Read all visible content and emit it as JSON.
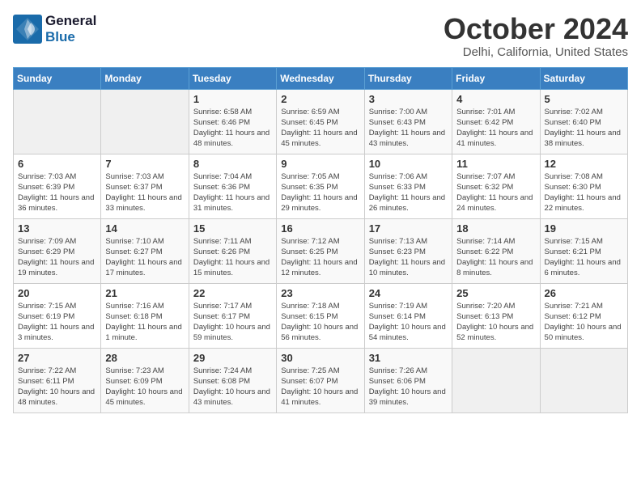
{
  "header": {
    "logo": {
      "line1": "General",
      "line2": "Blue"
    },
    "month": "October 2024",
    "location": "Delhi, California, United States"
  },
  "columns": [
    "Sunday",
    "Monday",
    "Tuesday",
    "Wednesday",
    "Thursday",
    "Friday",
    "Saturday"
  ],
  "weeks": [
    [
      {
        "day": "",
        "sunrise": "",
        "sunset": "",
        "daylight": ""
      },
      {
        "day": "",
        "sunrise": "",
        "sunset": "",
        "daylight": ""
      },
      {
        "day": "1",
        "sunrise": "Sunrise: 6:58 AM",
        "sunset": "Sunset: 6:46 PM",
        "daylight": "Daylight: 11 hours and 48 minutes."
      },
      {
        "day": "2",
        "sunrise": "Sunrise: 6:59 AM",
        "sunset": "Sunset: 6:45 PM",
        "daylight": "Daylight: 11 hours and 45 minutes."
      },
      {
        "day": "3",
        "sunrise": "Sunrise: 7:00 AM",
        "sunset": "Sunset: 6:43 PM",
        "daylight": "Daylight: 11 hours and 43 minutes."
      },
      {
        "day": "4",
        "sunrise": "Sunrise: 7:01 AM",
        "sunset": "Sunset: 6:42 PM",
        "daylight": "Daylight: 11 hours and 41 minutes."
      },
      {
        "day": "5",
        "sunrise": "Sunrise: 7:02 AM",
        "sunset": "Sunset: 6:40 PM",
        "daylight": "Daylight: 11 hours and 38 minutes."
      }
    ],
    [
      {
        "day": "6",
        "sunrise": "Sunrise: 7:03 AM",
        "sunset": "Sunset: 6:39 PM",
        "daylight": "Daylight: 11 hours and 36 minutes."
      },
      {
        "day": "7",
        "sunrise": "Sunrise: 7:03 AM",
        "sunset": "Sunset: 6:37 PM",
        "daylight": "Daylight: 11 hours and 33 minutes."
      },
      {
        "day": "8",
        "sunrise": "Sunrise: 7:04 AM",
        "sunset": "Sunset: 6:36 PM",
        "daylight": "Daylight: 11 hours and 31 minutes."
      },
      {
        "day": "9",
        "sunrise": "Sunrise: 7:05 AM",
        "sunset": "Sunset: 6:35 PM",
        "daylight": "Daylight: 11 hours and 29 minutes."
      },
      {
        "day": "10",
        "sunrise": "Sunrise: 7:06 AM",
        "sunset": "Sunset: 6:33 PM",
        "daylight": "Daylight: 11 hours and 26 minutes."
      },
      {
        "day": "11",
        "sunrise": "Sunrise: 7:07 AM",
        "sunset": "Sunset: 6:32 PM",
        "daylight": "Daylight: 11 hours and 24 minutes."
      },
      {
        "day": "12",
        "sunrise": "Sunrise: 7:08 AM",
        "sunset": "Sunset: 6:30 PM",
        "daylight": "Daylight: 11 hours and 22 minutes."
      }
    ],
    [
      {
        "day": "13",
        "sunrise": "Sunrise: 7:09 AM",
        "sunset": "Sunset: 6:29 PM",
        "daylight": "Daylight: 11 hours and 19 minutes."
      },
      {
        "day": "14",
        "sunrise": "Sunrise: 7:10 AM",
        "sunset": "Sunset: 6:27 PM",
        "daylight": "Daylight: 11 hours and 17 minutes."
      },
      {
        "day": "15",
        "sunrise": "Sunrise: 7:11 AM",
        "sunset": "Sunset: 6:26 PM",
        "daylight": "Daylight: 11 hours and 15 minutes."
      },
      {
        "day": "16",
        "sunrise": "Sunrise: 7:12 AM",
        "sunset": "Sunset: 6:25 PM",
        "daylight": "Daylight: 11 hours and 12 minutes."
      },
      {
        "day": "17",
        "sunrise": "Sunrise: 7:13 AM",
        "sunset": "Sunset: 6:23 PM",
        "daylight": "Daylight: 11 hours and 10 minutes."
      },
      {
        "day": "18",
        "sunrise": "Sunrise: 7:14 AM",
        "sunset": "Sunset: 6:22 PM",
        "daylight": "Daylight: 11 hours and 8 minutes."
      },
      {
        "day": "19",
        "sunrise": "Sunrise: 7:15 AM",
        "sunset": "Sunset: 6:21 PM",
        "daylight": "Daylight: 11 hours and 6 minutes."
      }
    ],
    [
      {
        "day": "20",
        "sunrise": "Sunrise: 7:15 AM",
        "sunset": "Sunset: 6:19 PM",
        "daylight": "Daylight: 11 hours and 3 minutes."
      },
      {
        "day": "21",
        "sunrise": "Sunrise: 7:16 AM",
        "sunset": "Sunset: 6:18 PM",
        "daylight": "Daylight: 11 hours and 1 minute."
      },
      {
        "day": "22",
        "sunrise": "Sunrise: 7:17 AM",
        "sunset": "Sunset: 6:17 PM",
        "daylight": "Daylight: 10 hours and 59 minutes."
      },
      {
        "day": "23",
        "sunrise": "Sunrise: 7:18 AM",
        "sunset": "Sunset: 6:15 PM",
        "daylight": "Daylight: 10 hours and 56 minutes."
      },
      {
        "day": "24",
        "sunrise": "Sunrise: 7:19 AM",
        "sunset": "Sunset: 6:14 PM",
        "daylight": "Daylight: 10 hours and 54 minutes."
      },
      {
        "day": "25",
        "sunrise": "Sunrise: 7:20 AM",
        "sunset": "Sunset: 6:13 PM",
        "daylight": "Daylight: 10 hours and 52 minutes."
      },
      {
        "day": "26",
        "sunrise": "Sunrise: 7:21 AM",
        "sunset": "Sunset: 6:12 PM",
        "daylight": "Daylight: 10 hours and 50 minutes."
      }
    ],
    [
      {
        "day": "27",
        "sunrise": "Sunrise: 7:22 AM",
        "sunset": "Sunset: 6:11 PM",
        "daylight": "Daylight: 10 hours and 48 minutes."
      },
      {
        "day": "28",
        "sunrise": "Sunrise: 7:23 AM",
        "sunset": "Sunset: 6:09 PM",
        "daylight": "Daylight: 10 hours and 45 minutes."
      },
      {
        "day": "29",
        "sunrise": "Sunrise: 7:24 AM",
        "sunset": "Sunset: 6:08 PM",
        "daylight": "Daylight: 10 hours and 43 minutes."
      },
      {
        "day": "30",
        "sunrise": "Sunrise: 7:25 AM",
        "sunset": "Sunset: 6:07 PM",
        "daylight": "Daylight: 10 hours and 41 minutes."
      },
      {
        "day": "31",
        "sunrise": "Sunrise: 7:26 AM",
        "sunset": "Sunset: 6:06 PM",
        "daylight": "Daylight: 10 hours and 39 minutes."
      },
      {
        "day": "",
        "sunrise": "",
        "sunset": "",
        "daylight": ""
      },
      {
        "day": "",
        "sunrise": "",
        "sunset": "",
        "daylight": ""
      }
    ]
  ]
}
